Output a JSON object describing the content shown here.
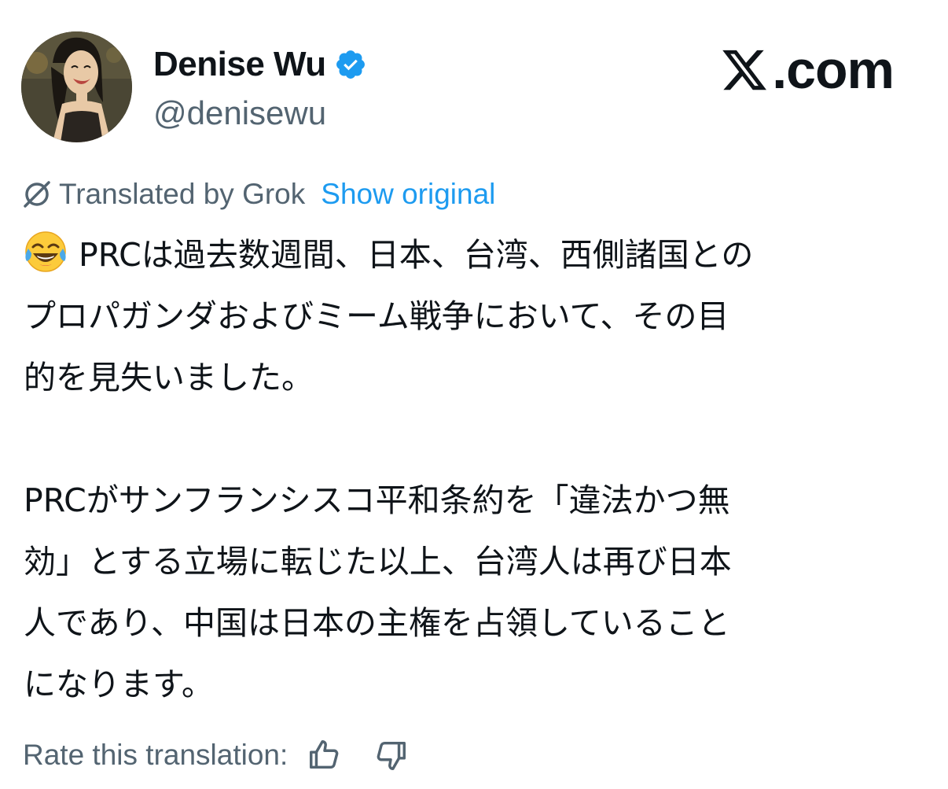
{
  "author": {
    "display_name": "Denise Wu",
    "handle": "@denisewu",
    "verified": true
  },
  "brand": {
    "label": ".com"
  },
  "translation": {
    "translated_by": "Translated by Grok",
    "show_original": "Show original"
  },
  "tweet": {
    "emoji": "face-with-tears-of-joy",
    "lines": [
      "PRCは過去数週間、日本、台湾、西側諸国との",
      "プロパガンダおよびミーム戦争において、その目",
      "的を見失いました。",
      "",
      "PRCがサンフランシスコ平和条約を「違法かつ無",
      "効」とする立場に転じた以上、台湾人は再び日本",
      "人であり、中国は日本の主権を占領していること",
      "になります。"
    ]
  },
  "rating": {
    "label": "Rate this translation:"
  },
  "colors": {
    "text": "#0f1419",
    "secondary": "#536471",
    "accent": "#1d9bf0"
  }
}
